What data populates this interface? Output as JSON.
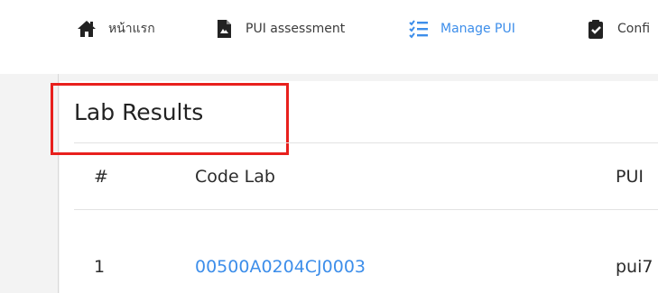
{
  "nav": {
    "items": [
      {
        "label": "หน้าแรก",
        "icon": "home-icon"
      },
      {
        "label": "PUI assessment",
        "icon": "document-icon"
      },
      {
        "label": "Manage PUI",
        "icon": "checklist-icon",
        "active": true
      },
      {
        "label": "Confi",
        "icon": "clipboard-check-icon"
      }
    ]
  },
  "card": {
    "title": "Lab Results"
  },
  "table": {
    "headers": [
      "#",
      "Code Lab",
      "PUI"
    ],
    "rows": [
      {
        "num": "1",
        "code": "00500A0204CJ0003",
        "pui": "pui7"
      }
    ]
  },
  "colors": {
    "accent": "#3d8eea",
    "highlight": "#e8201d",
    "text": "#2b2b2b"
  }
}
